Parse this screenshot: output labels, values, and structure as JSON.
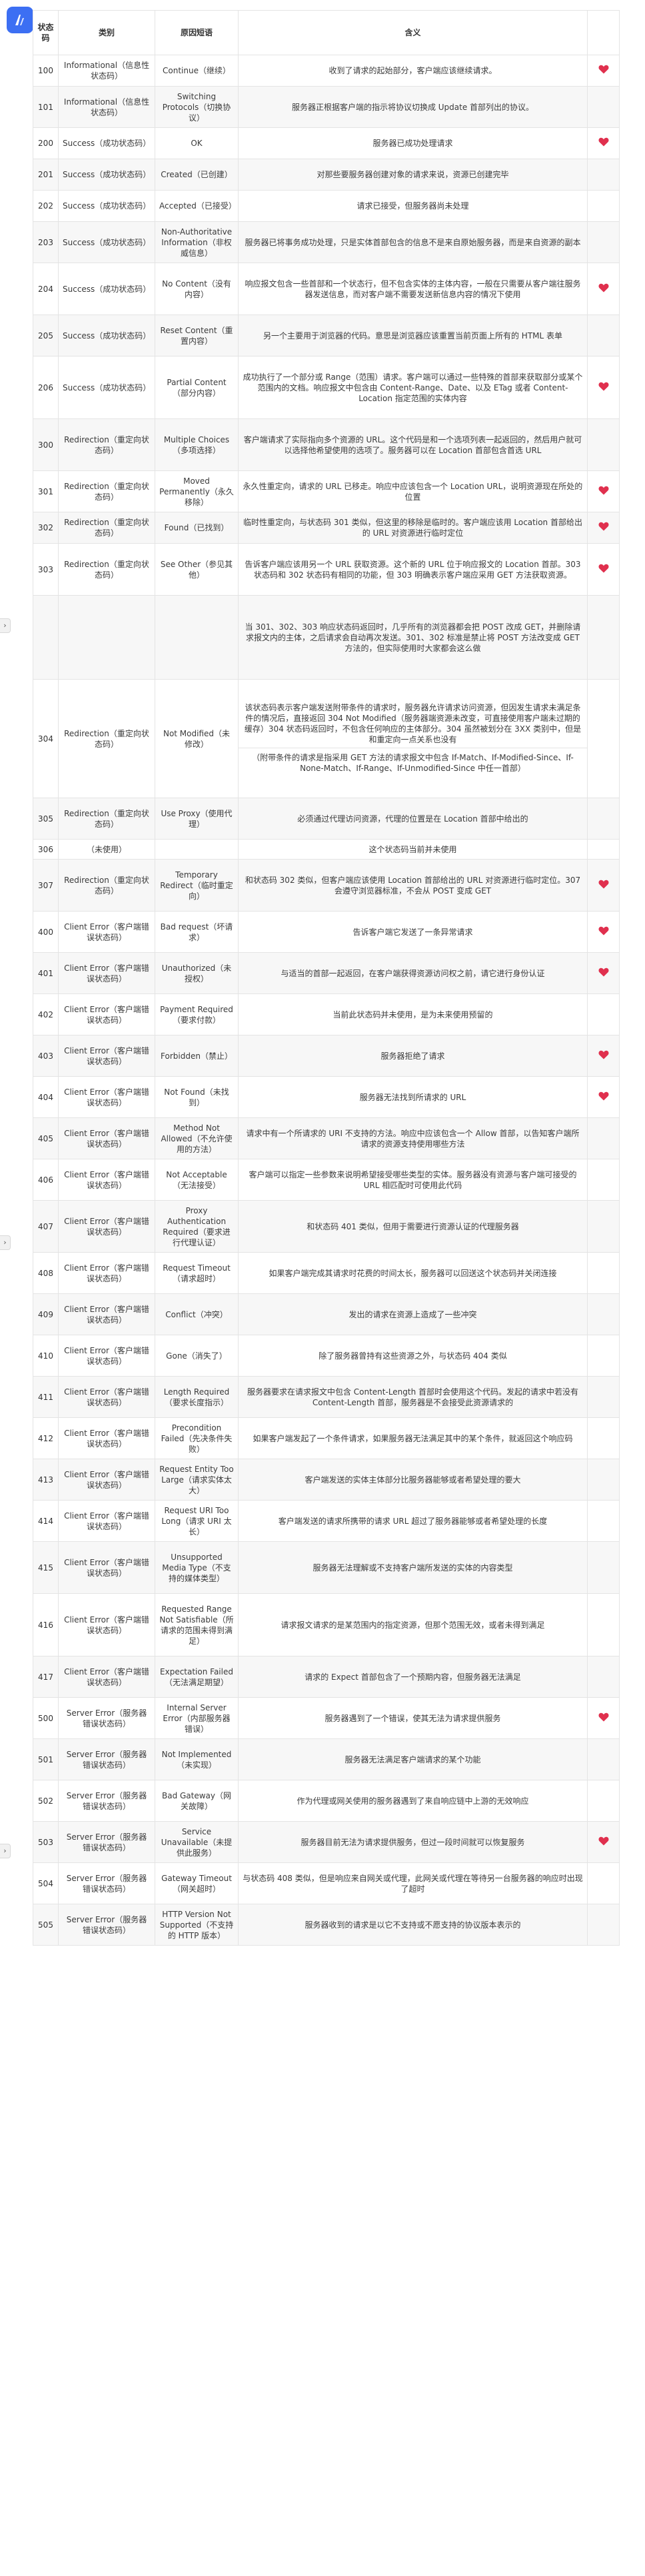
{
  "header": {
    "col_code": "状态码",
    "col_category": "类别",
    "col_phrase": "原因短语",
    "col_meaning": "含义",
    "col_flag": ""
  },
  "rows": [
    {
      "code": "100",
      "category": "Informational（信息性状态码）",
      "phrase": "Continue（继续）",
      "meaning": "收到了请求的起始部分，客户端应该继续请求。",
      "flag": true,
      "h": 47
    },
    {
      "code": "101",
      "category": "Informational（信息性状态码）",
      "phrase": "Switching Protocols（切换协议）",
      "meaning": "服务器正根据客户端的指示将协议切换成 Update 首部列出的协议。",
      "flag": false,
      "h": 62
    },
    {
      "code": "200",
      "category": "Success（成功状态码）",
      "phrase": "OK",
      "meaning": "服务器已成功处理请求",
      "flag": true,
      "h": 47
    },
    {
      "code": "201",
      "category": "Success（成功状态码）",
      "phrase": "Created（已创建）",
      "meaning": "对那些要服务器创建对象的请求来说，资源已创建完毕",
      "flag": false,
      "h": 47
    },
    {
      "code": "202",
      "category": "Success（成功状态码）",
      "phrase": "Accepted（已接受）",
      "meaning": "请求已接受，但服务器尚未处理",
      "flag": false,
      "h": 47
    },
    {
      "code": "203",
      "category": "Success（成功状态码）",
      "phrase": "Non-Authoritative Information（非权威信息）",
      "meaning": "服务器已将事务成功处理，只是实体首部包含的信息不是来自原始服务器，而是来自资源的副本",
      "flag": false,
      "h": 62
    },
    {
      "code": "204",
      "category": "Success（成功状态码）",
      "phrase": "No Content（没有内容）",
      "meaning": "响应报文包含一些首部和一个状态行，但不包含实体的主体内容，一般在只需要从客户端往服务器发送信息，而对客户端不需要发送新信息内容的情况下使用",
      "emph_all": false,
      "flag": true,
      "h": 78
    },
    {
      "code": "205",
      "category": "Success（成功状态码）",
      "phrase": "Reset Content（重置内容）",
      "meaning": "另一个主要用于浏览器的代码。意思是浏览器应该重置当前页面上所有的 HTML 表单",
      "flag": false,
      "h": 62
    },
    {
      "code": "206",
      "category": "Success（成功状态码）",
      "phrase": "Partial Content（部分内容）",
      "meaning": "成功执行了一个部分或 Range（范围）请求。客户端可以通过一些特殊的首部来获取部分或某个范围内的文档。响应报文中包含由 Content-Range、Date、以及 ETag 或者 Content-Location 指定范围的实体内容",
      "flag": true,
      "h": 94
    },
    {
      "code": "300",
      "category": "Redirection（重定向状态码）",
      "phrase": "Multiple Choices（多项选择）",
      "meaning": "客户端请求了实际指向多个资源的 URL。这个代码是和一个选项列表一起返回的，然后用户就可以选择他希望使用的选项了。服务器可以在 Location 首部包含首选 URL",
      "flag": false,
      "h": 78
    },
    {
      "code": "301",
      "category": "Redirection（重定向状态码）",
      "phrase": "Moved Permanently（永久移除）",
      "meaning": "永久性重定向，请求的 URL 已移走。响应中应该包含一个 Location URL，说明资源现在所处的位置",
      "flag": true,
      "h": 62
    },
    {
      "code": "302",
      "category": "Redirection（重定向状态码）",
      "phrase": "Found（已找到）",
      "meaning": "临时性重定向，与状态码 301 类似，但这里的移除是临时的。客户端应该用 Location 首部给出的 URL 对资源进行临时定位",
      "flag": true,
      "h": 47
    },
    {
      "code": "303",
      "category": "Redirection（重定向状态码）",
      "phrase": "See Other（参见其他）",
      "meaning": "告诉客户端应该用另一个 URL 获取资源。这个新的 URL 位于响应报文的 Location 首部。303 状态码和 302 状态码有相同的功能，但 303 明确表示客户端应采用 GET 方法获取资源。",
      "flag": true,
      "h": 78
    },
    {
      "code": "",
      "category": "",
      "phrase": "",
      "meaning": "当 301、302、303 响应状态码返回时，几乎所有的浏览器都会把 POST 改成 GET，并删除请求报文内的主体，之后请求会自动再次发送。301、302 标准是禁止将 POST 方法改变成 GET 方法的，但实际使用时大家都会这么做",
      "flag": false,
      "h": 126
    },
    {
      "code": "304",
      "category": "Redirection（重定向状态码）",
      "phrase": "Not Modified（未修改）",
      "meaning": "该状态码表示客户端发送附带条件的请求时，服务器允许请求访问资源，但因发生请求未满足条件的情况后，直接返回 304 Not Modified（服务器端资源未改变，可直接使用客户端未过期的缓存）304 状态码返回时，不包含任何响应的主体部分。304 虽然被划分在 3XX 类别中，但是和重定向一点关系也没有",
      "meaning2": "（附带条件的请求是指采用 GET 方法的请求报文中包含 If-Match、If-Modified-Since、If-None-Match、If-Range、If-Unmodified-Since 中任一首部）",
      "flag": false,
      "h": 178
    },
    {
      "code": "305",
      "category": "Redirection（重定向状态码）",
      "phrase": "Use Proxy（使用代理）",
      "meaning": "必须通过代理访问资源，代理的位置是在 Location 首部中给出的",
      "flag": false,
      "h": 62
    },
    {
      "code": "306",
      "category": "（未使用）",
      "phrase": "",
      "meaning": "这个状态码当前并未使用",
      "flag": false,
      "h": 30
    },
    {
      "code": "307",
      "category": "Redirection（重定向状态码）",
      "phrase": "Temporary Redirect（临时重定向）",
      "meaning": "和状态码 302 类似，但客户端应该使用 Location 首部给出的 URL 对资源进行临时定位。307 会遵守浏览器标准，不会从 POST 变成 GET",
      "flag": true,
      "h": 78
    },
    {
      "code": "400",
      "category": "Client Error（客户端错误状态码）",
      "phrase": "Bad request（坏请求）",
      "meaning": "告诉客户端它发送了一条异常请求",
      "flag": true,
      "h": 62
    },
    {
      "code": "401",
      "category": "Client Error（客户端错误状态码）",
      "phrase": "Unauthorized（未授权）",
      "meaning": "与适当的首部一起返回，在客户端获得资源访问权之前，请它进行身份认证",
      "flag": true,
      "h": 62
    },
    {
      "code": "402",
      "category": "Client Error（客户端错误状态码）",
      "phrase": "Payment Required（要求付款）",
      "meaning": "当前此状态码并未使用，是为未来使用预留的",
      "flag": false,
      "h": 62
    },
    {
      "code": "403",
      "category": "Client Error（客户端错误状态码）",
      "phrase": "Forbidden（禁止）",
      "meaning": "服务器拒绝了请求",
      "flag": true,
      "h": 62
    },
    {
      "code": "404",
      "category": "Client Error（客户端错误状态码）",
      "phrase": "Not Found（未找到）",
      "meaning": "服务器无法找到所请求的 URL",
      "flag": true,
      "h": 62
    },
    {
      "code": "405",
      "category": "Client Error（客户端错误状态码）",
      "phrase": "Method Not Allowed（不允许使用的方法）",
      "meaning": "请求中有一个所请求的 URI 不支持的方法。响应中应该包含一个 Allow 首部，以告知客户端所请求的资源支持使用哪些方法",
      "flag": false,
      "h": 62
    },
    {
      "code": "406",
      "category": "Client Error（客户端错误状态码）",
      "phrase": "Not Acceptable（无法接受）",
      "meaning": "客户端可以指定一些参数来说明希望接受哪些类型的实体。服务器没有资源与客户端可接受的 URL 相匹配时可使用此代码",
      "flag": false,
      "h": 62
    },
    {
      "code": "407",
      "category": "Client Error（客户端错误状态码）",
      "phrase": "Proxy Authentication Required（要求进行代理认证）",
      "meaning": "和状态码 401 类似，但用于需要进行资源认证的代理服务器",
      "flag": false,
      "h": 78
    },
    {
      "code": "408",
      "category": "Client Error（客户端错误状态码）",
      "phrase": "Request Timeout（请求超时）",
      "meaning": "如果客户端完成其请求时花费的时间太长，服务器可以回送这个状态码并关闭连接",
      "flag": false,
      "h": 62
    },
    {
      "code": "409",
      "category": "Client Error（客户端错误状态码）",
      "phrase": "Conflict（冲突）",
      "meaning": "发出的请求在资源上造成了一些冲突",
      "flag": false,
      "h": 62
    },
    {
      "code": "410",
      "category": "Client Error（客户端错误状态码）",
      "phrase": "Gone（消失了）",
      "meaning": "除了服务器曾持有这些资源之外，与状态码 404 类似",
      "flag": false,
      "h": 62
    },
    {
      "code": "411",
      "category": "Client Error（客户端错误状态码）",
      "phrase": "Length Required（要求长度指示）",
      "meaning": "服务器要求在请求报文中包含 Content-Length 首部时会使用这个代码。发起的请求中若没有 Content-Length 首部，服务器是不会接受此资源请求的",
      "flag": false,
      "h": 62
    },
    {
      "code": "412",
      "category": "Client Error（客户端错误状态码）",
      "phrase": "Precondition Failed（先决条件失败）",
      "meaning": "如果客户端发起了一个条件请求，如果服务器无法满足其中的某个条件，就返回这个响应码",
      "flag": false,
      "h": 62
    },
    {
      "code": "413",
      "category": "Client Error（客户端错误状态码）",
      "phrase": "Request Entity Too Large（请求实体太大）",
      "meaning": "客户端发送的实体主体部分比服务器能够或者希望处理的要大",
      "flag": false,
      "h": 62
    },
    {
      "code": "414",
      "category": "Client Error（客户端错误状态码）",
      "phrase": "Request URI Too Long（请求 URI 太长）",
      "meaning": "客户端发送的请求所携带的请求 URL 超过了服务器能够或者希望处理的长度",
      "flag": false,
      "h": 62
    },
    {
      "code": "415",
      "category": "Client Error（客户端错误状态码）",
      "phrase": "Unsupported Media Type（不支持的媒体类型）",
      "meaning": "服务器无法理解或不支持客户端所发送的实体的内容类型",
      "flag": false,
      "h": 78
    },
    {
      "code": "416",
      "category": "Client Error（客户端错误状态码）",
      "phrase": "Requested Range Not Satisfiable（所请求的范围未得到满足）",
      "meaning": "请求报文请求的是某范围内的指定资源，但那个范围无效，或者未得到满足",
      "flag": false,
      "h": 94
    },
    {
      "code": "417",
      "category": "Client Error（客户端错误状态码）",
      "phrase": "Expectation Failed（无法满足期望）",
      "meaning": "请求的 Expect 首部包含了一个预期内容，但服务器无法满足",
      "flag": false,
      "h": 62
    },
    {
      "code": "500",
      "category": "Server Error（服务器错误状态码）",
      "phrase": "Internal Server Error（内部服务器错误）",
      "meaning": "服务器遇到了一个错误，使其无法为请求提供服务",
      "flag": true,
      "h": 62
    },
    {
      "code": "501",
      "category": "Server Error（服务器错误状态码）",
      "phrase": "Not Implemented（未实现）",
      "meaning": "服务器无法满足客户端请求的某个功能",
      "flag": false,
      "h": 62
    },
    {
      "code": "502",
      "category": "Server Error（服务器错误状态码）",
      "phrase": "Bad Gateway（网关故障）",
      "meaning": "作为代理或网关使用的服务器遇到了来自响应链中上游的无效响应",
      "flag": false,
      "h": 62
    },
    {
      "code": "503",
      "category": "Server Error（服务器错误状态码）",
      "phrase": "Service Unavailable（未提供此服务）",
      "meaning": "服务器目前无法为请求提供服务，但过一段时间就可以恢复服务",
      "flag": true,
      "h": 62
    },
    {
      "code": "504",
      "category": "Server Error（服务器错误状态码）",
      "phrase": "Gateway Timeout（网关超时）",
      "meaning": "与状态码 408 类似，但是响应来自网关或代理，此网关或代理在等待另一台服务器的响应时出现了超时",
      "flag": false,
      "h": 62
    },
    {
      "code": "505",
      "category": "Server Error（服务器错误状态码）",
      "phrase": "HTTP Version Not Supported（不支持的 HTTP 版本）",
      "meaning": "服务器收到的请求是以它不支持或不愿支持的协议版本表示的",
      "flag": false,
      "h": 62
    }
  ],
  "colors": {
    "heart": "#e0304e",
    "logo": "#3c6ff3"
  }
}
